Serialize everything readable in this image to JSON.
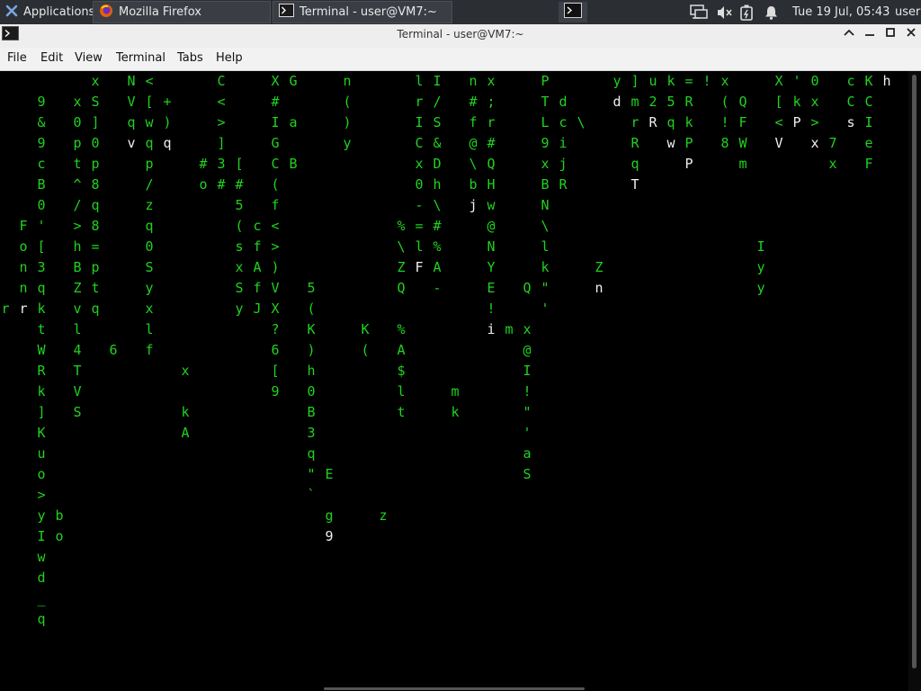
{
  "panel": {
    "applications_label": "Applications",
    "tasks": [
      {
        "label": "Mozilla Firefox",
        "icon": "firefox-icon"
      },
      {
        "label": "Terminal - user@VM7:~",
        "icon": "terminal-icon"
      }
    ],
    "clock": "Tue 19 Jul, 05:43",
    "user": "user"
  },
  "window": {
    "title": "Terminal - user@VM7:~"
  },
  "menubar": {
    "items": [
      "File",
      "Edit",
      "View",
      "Terminal",
      "Tabs",
      "Help"
    ]
  },
  "terminal": {
    "colors": {
      "rain": "#1fd31f",
      "head": "#f0f0f0",
      "background": "#000000"
    },
    "columns": [
      {
        "start": 11,
        "chars": "r",
        "head": ""
      },
      {
        "start": 7,
        "chars": "Fonn",
        "head": "r"
      },
      {
        "start": 1,
        "chars": "9&9cB0'[3qktWRk]Kuo>yIwd_q",
        "head": ""
      },
      {
        "start": 21,
        "chars": "bo",
        "head": ""
      },
      {
        "start": 1,
        "chars": "x0pt^/>hBZvl4TVS",
        "head": ""
      },
      {
        "start": 0,
        "chars": "xS]0p8q8=ptq",
        "head": ""
      },
      {
        "start": 13,
        "chars": "6",
        "head": ""
      },
      {
        "start": 0,
        "chars": "NVq",
        "head": "v"
      },
      {
        "start": 0,
        "chars": "<[wqp/zq0Syxlf",
        "head": ""
      },
      {
        "start": 1,
        "chars": "+)",
        "head": "q"
      },
      {
        "start": 14,
        "chars": "x kA",
        "head": ""
      },
      {
        "start": 4,
        "chars": "#o",
        "head": ""
      },
      {
        "start": 0,
        "chars": "C<>]3#",
        "head": ""
      },
      {
        "start": 4,
        "chars": "[#5(sxSy",
        "head": ""
      },
      {
        "start": 7,
        "chars": "cfAfJ",
        "head": ""
      },
      {
        "start": 0,
        "chars": "X#IGC(f<>)VX?6[9",
        "head": ""
      },
      {
        "start": 0,
        "chars": "G a B",
        "head": ""
      },
      {
        "start": 10,
        "chars": "5(K)h0B3q\"`",
        "head": ""
      },
      {
        "start": 19,
        "chars": "E g",
        "head": "9"
      },
      {
        "start": 0,
        "chars": "n()y",
        "head": ""
      },
      {
        "start": 12,
        "chars": "K(",
        "head": ""
      },
      {
        "start": 21,
        "chars": "z",
        "head": ""
      },
      {
        "start": 7,
        "chars": "%\\ZQ %A$lt",
        "head": ""
      },
      {
        "start": 0,
        "chars": "lrICx0-=l",
        "head": "F"
      },
      {
        "start": 0,
        "chars": "I/S&Dh\\#%A-",
        "head": ""
      },
      {
        "start": 15,
        "chars": "mk",
        "head": ""
      },
      {
        "start": 0,
        "chars": "n#f@\\b",
        "head": "j"
      },
      {
        "start": 0,
        "chars": "x;r#QHw@NYE!",
        "head": "i"
      },
      {
        "start": 12,
        "chars": "m",
        "head": ""
      },
      {
        "start": 10,
        "chars": "Q x@I!\"'aS",
        "head": ""
      },
      {
        "start": 0,
        "chars": "PTL9xBN\\lk\"'",
        "head": ""
      },
      {
        "start": 1,
        "chars": "dcijR",
        "head": ""
      },
      {
        "start": 2,
        "chars": "\\",
        "head": ""
      },
      {
        "start": 9,
        "chars": "Z",
        "head": "n"
      },
      {
        "start": 0,
        "chars": "y",
        "head": "d"
      },
      {
        "start": 0,
        "chars": "]mrRq",
        "head": "T"
      },
      {
        "start": 0,
        "chars": "u2",
        "head": "R"
      },
      {
        "start": 0,
        "chars": "k5q",
        "head": "w"
      },
      {
        "start": 0,
        "chars": "=RkP",
        "head": "P"
      },
      {
        "start": 0,
        "chars": "!",
        "head": ""
      },
      {
        "start": 0,
        "chars": "x(!8",
        "head": ""
      },
      {
        "start": 1,
        "chars": "QFWm",
        "head": ""
      },
      {
        "start": 8,
        "chars": "Iyy",
        "head": ""
      },
      {
        "start": 0,
        "chars": "X[<",
        "head": "V"
      },
      {
        "start": 0,
        "chars": "'k",
        "head": "P"
      },
      {
        "start": 0,
        "chars": "0x>",
        "head": "x"
      },
      {
        "start": 3,
        "chars": "7x",
        "head": ""
      },
      {
        "start": 0,
        "chars": "cC",
        "head": "s"
      },
      {
        "start": 0,
        "chars": "KCIeF",
        "head": ""
      },
      {
        "start": 0,
        "chars": "",
        "head": "h"
      }
    ]
  }
}
